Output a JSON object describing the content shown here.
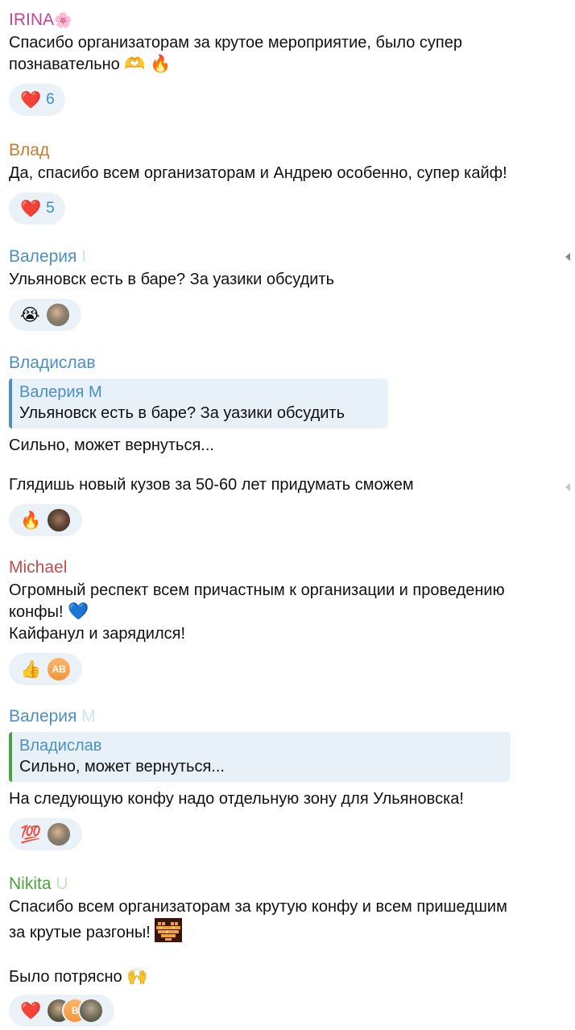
{
  "colors": {
    "irina": "#c0459a",
    "vlad": "#c97a2a",
    "valeria": "#4a90c4",
    "vladislav": "#4a90c4",
    "michael": "#c0504d",
    "nikita": "#4aa33a",
    "reaction_bg": "#eaf2f8",
    "reaction_count": "#3a8fc9"
  },
  "messages": [
    {
      "author": "IRINA",
      "author_emoji": "🌸",
      "lines": [
        "Спасибо организаторам за крутое мероприятие, было супер",
        "познавательно"
      ],
      "line_emojis": [
        "🫶",
        "🔥"
      ],
      "reaction": {
        "emoji": "❤️",
        "count": "6"
      }
    },
    {
      "author": "Влад",
      "lines": [
        "Да, спасибо всем организаторам и Андрею особенно, супер кайф!"
      ],
      "reaction": {
        "emoji": "❤️",
        "count": "5"
      }
    },
    {
      "author": "Валерия",
      "author_suffix": "I",
      "lines": [
        "Ульяновск есть в баре? За уазики обсудить"
      ],
      "reaction": {
        "emoji": "😭",
        "avatars": [
          "avatar-photo"
        ]
      }
    },
    {
      "author": "Владислав",
      "reply": {
        "author": "Валерия М",
        "text": "Ульяновск есть в баре? За уазики обсудить"
      },
      "lines": [
        "Сильно, может вернуться...",
        "",
        "Глядишь новый кузов за 50-60 лет придумать сможем"
      ],
      "reaction": {
        "emoji": "🔥",
        "avatars": [
          "avatar-photo"
        ]
      }
    },
    {
      "author": "Michael",
      "lines": [
        "Огромный респект всем причастным к организации и проведению",
        "конфы!",
        "Кайфанул и зарядился!"
      ],
      "line_emojis": [
        "💙"
      ],
      "reaction": {
        "emoji": "👍",
        "avatars": [
          "AB"
        ]
      }
    },
    {
      "author": "Валерия",
      "author_suffix": "М",
      "reply": {
        "author": "Владислав",
        "text": "Сильно, может вернуться..."
      },
      "lines": [
        "На следующую конфу надо отдельную зону для Ульяновска!"
      ],
      "reaction": {
        "emoji": "💯",
        "avatars": [
          "avatar-photo"
        ]
      }
    },
    {
      "author": "Nikita",
      "author_suffix": "U",
      "lines": [
        "Спасибо всем организаторам за крутую конфу и всем пришедшим",
        "за крутые разгоны!",
        "",
        "Было потрясно"
      ],
      "line_emojis": [
        "heart-pixel-sticker",
        "🙌"
      ],
      "reaction": {
        "emoji": "❤️",
        "avatars": [
          "avatar-photo",
          "B",
          "avatar-photo"
        ]
      }
    }
  ]
}
